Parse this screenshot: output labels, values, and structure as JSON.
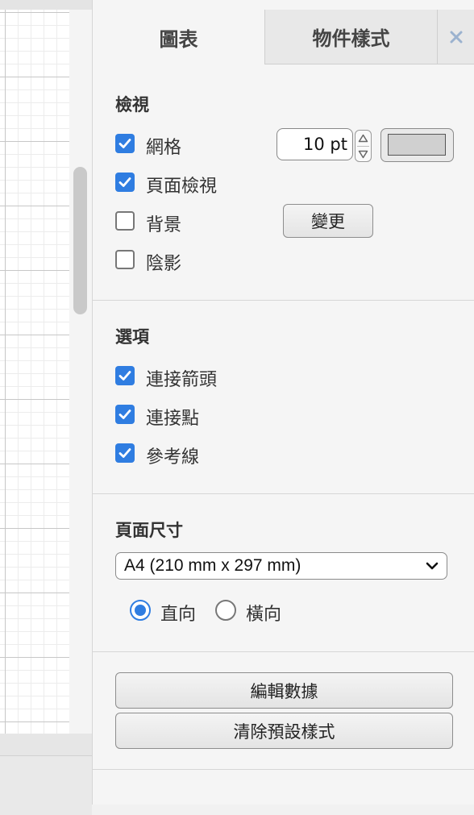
{
  "tabs": {
    "diagram": "圖表",
    "style": "物件樣式",
    "close": "×"
  },
  "view": {
    "title": "檢視",
    "grid_label": "網格",
    "grid_checked": true,
    "grid_size_value": "10 pt",
    "grid_color": "#d0d0d0",
    "page_view_label": "頁面檢視",
    "page_view_checked": true,
    "background_label": "背景",
    "background_checked": false,
    "change_button": "變更",
    "shadow_label": "陰影",
    "shadow_checked": false
  },
  "options": {
    "title": "選項",
    "connection_arrows": "連接箭頭",
    "connection_points": "連接點",
    "guides": "參考線"
  },
  "page_size": {
    "title": "頁面尺寸",
    "selected": "A4 (210 mm x 297 mm)",
    "portrait": "直向",
    "landscape": "橫向",
    "orientation_selected": "portrait"
  },
  "actions": {
    "edit_data": "編輯數據",
    "clear_default_style": "清除預設樣式"
  },
  "colors": {
    "accent": "#2f7de1"
  }
}
